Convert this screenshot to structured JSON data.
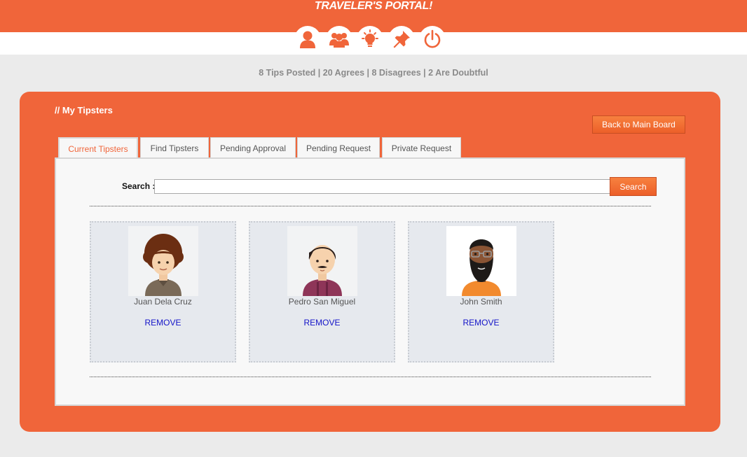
{
  "header": {
    "brand": "TRAVELER'S PORTAL!",
    "nav_icons": [
      "user-icon",
      "group-icon",
      "lightbulb-icon",
      "pin-icon",
      "power-icon"
    ]
  },
  "stats": {
    "text": "8 Tips Posted | 20 Agrees | 8 Disagrees | 2 Are Doubtful"
  },
  "panel": {
    "title": "// My Tipsters",
    "back_label": "Back to Main Board"
  },
  "tabs": [
    {
      "label": "Current Tipsters",
      "active": true
    },
    {
      "label": "Find Tipsters",
      "active": false
    },
    {
      "label": "Pending Approval",
      "active": false
    },
    {
      "label": "Pending Request",
      "active": false
    },
    {
      "label": "Private Request",
      "active": false
    }
  ],
  "search": {
    "label": "Search :",
    "value": "",
    "button_label": "Search"
  },
  "tipsters": [
    {
      "name": "Juan Dela Cruz",
      "action": "REMOVE"
    },
    {
      "name": "Pedro San Miguel",
      "action": "REMOVE"
    },
    {
      "name": "John Smith",
      "action": "REMOVE"
    }
  ],
  "colors": {
    "accent": "#f0653a",
    "link": "#1414c8",
    "background": "#ebebeb"
  }
}
